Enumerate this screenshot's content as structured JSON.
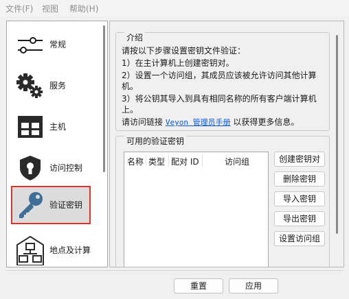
{
  "menubar": {
    "items": [
      {
        "label": "文件(F)"
      },
      {
        "label": "视图"
      },
      {
        "label": "帮助(H)"
      }
    ]
  },
  "sidebar": {
    "items": [
      {
        "label": "常规",
        "icon": "sliders-icon"
      },
      {
        "label": "服务",
        "icon": "gears-icon"
      },
      {
        "label": "主机",
        "icon": "grid-window-icon"
      },
      {
        "label": "访问控制",
        "icon": "shield-keyhole-icon"
      },
      {
        "label": "验证密钥",
        "icon": "key-icon",
        "selected": true
      },
      {
        "label": "地点及计算",
        "icon": "network-computers-icon"
      }
    ]
  },
  "intro": {
    "title": "介绍",
    "line1": "请按以下步骤设置密钥文件验证：",
    "line2": "1）在主计算机上创建密钥对。",
    "line3": "2）设置一个访问组，其成员应该被允许访问其他计算机。",
    "line4": "3）将公钥其导入到具有相同名称的所有客户端计算机上。",
    "line5_before": "请访问链接 ",
    "link_text": "Veyon 管理员手册",
    "line5_after": " 以获得更多信息。"
  },
  "keys": {
    "title": "可用的验证密钥",
    "columns": [
      "名称",
      "类型",
      "配对 ID",
      "访问组"
    ],
    "buttons": {
      "create_pair": "创建密钥对",
      "delete": "删除密钥",
      "import": "导入密钥",
      "export": "导出密钥",
      "set_group": "设置访问组"
    }
  },
  "footer": {
    "reset": "重置",
    "apply": "应用"
  },
  "colors": {
    "selection_border": "#d9342b",
    "link": "#0a57d0",
    "key_icon": "#3f6f96"
  }
}
